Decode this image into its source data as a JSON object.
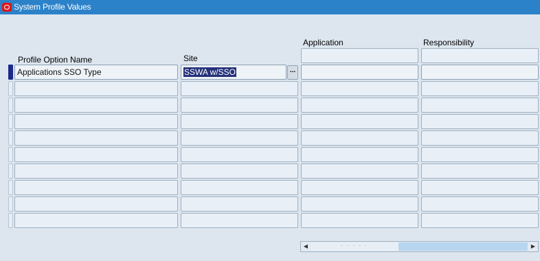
{
  "window": {
    "title": "System Profile Values"
  },
  "columns": {
    "profile_option": "Profile Option Name",
    "site": "Site",
    "application": "Application",
    "responsibility": "Responsibility"
  },
  "rows": [
    {
      "profile_option": "Applications SSO Type",
      "site": "SSWA w/SSO",
      "application": "",
      "responsibility": ""
    },
    {
      "profile_option": "",
      "site": "",
      "application": "",
      "responsibility": ""
    },
    {
      "profile_option": "",
      "site": "",
      "application": "",
      "responsibility": ""
    },
    {
      "profile_option": "",
      "site": "",
      "application": "",
      "responsibility": ""
    },
    {
      "profile_option": "",
      "site": "",
      "application": "",
      "responsibility": ""
    },
    {
      "profile_option": "",
      "site": "",
      "application": "",
      "responsibility": ""
    },
    {
      "profile_option": "",
      "site": "",
      "application": "",
      "responsibility": ""
    },
    {
      "profile_option": "",
      "site": "",
      "application": "",
      "responsibility": ""
    },
    {
      "profile_option": "",
      "site": "",
      "application": "",
      "responsibility": ""
    },
    {
      "profile_option": "",
      "site": "",
      "application": "",
      "responsibility": ""
    }
  ],
  "lov_button": "...",
  "icons": {
    "window": "oracle-icon",
    "scroll_left": "scroll-left-arrow-icon",
    "scroll_right": "scroll-right-arrow-icon"
  },
  "colors": {
    "titlebar": "#2c82c9",
    "background": "#dde6ef",
    "field": "#e8eff6",
    "selection": "#25317a",
    "current_record": "#1b2a8a"
  }
}
